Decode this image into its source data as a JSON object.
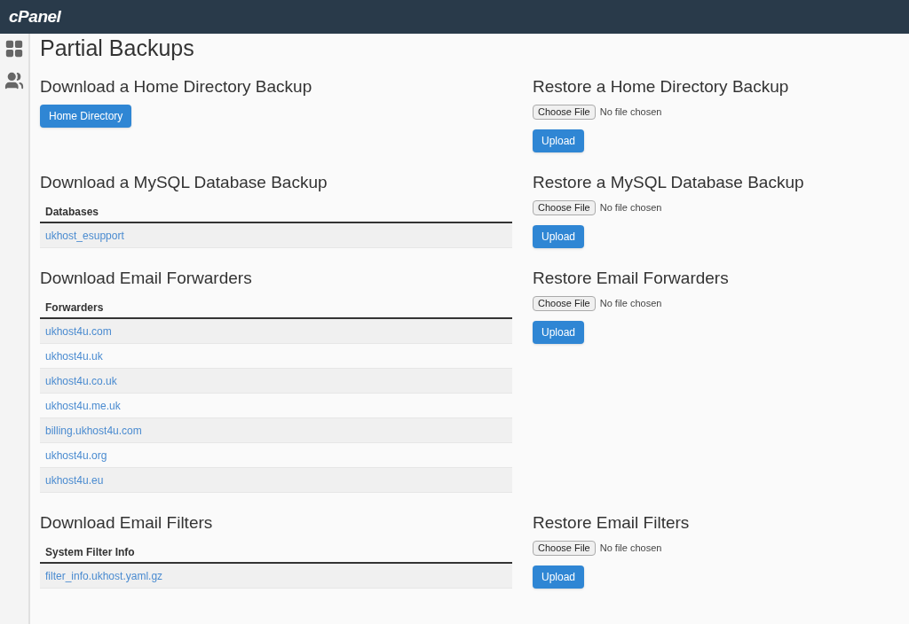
{
  "header": {
    "logo": "cPanel"
  },
  "page_title": "Partial Backups",
  "sections": [
    {
      "download": {
        "kind": "button",
        "title": "Download a Home Directory Backup",
        "button": "Home Directory"
      },
      "restore": {
        "title": "Restore a Home Directory Backup",
        "choose_button": "Choose File",
        "file_status": "No file chosen",
        "upload_button": "Upload"
      }
    },
    {
      "download": {
        "kind": "table",
        "title": "Download a MySQL Database Backup",
        "column": "Databases",
        "rows": [
          "ukhost_esupport"
        ]
      },
      "restore": {
        "title": "Restore a MySQL Database Backup",
        "choose_button": "Choose File",
        "file_status": "No file chosen",
        "upload_button": "Upload"
      }
    },
    {
      "download": {
        "kind": "table",
        "title": "Download Email Forwarders",
        "column": "Forwarders",
        "rows": [
          "ukhost4u.com",
          "ukhost4u.uk",
          "ukhost4u.co.uk",
          "ukhost4u.me.uk",
          "billing.ukhost4u.com",
          "ukhost4u.org",
          "ukhost4u.eu"
        ]
      },
      "restore": {
        "title": "Restore Email Forwarders",
        "choose_button": "Choose File",
        "file_status": "No file chosen",
        "upload_button": "Upload"
      }
    },
    {
      "download": {
        "kind": "table",
        "title": "Download Email Filters",
        "column": "System Filter Info",
        "rows": [
          "filter_info.ukhost.yaml.gz"
        ]
      },
      "restore": {
        "title": "Restore Email Filters",
        "choose_button": "Choose File",
        "file_status": "No file chosen",
        "upload_button": "Upload"
      }
    }
  ]
}
